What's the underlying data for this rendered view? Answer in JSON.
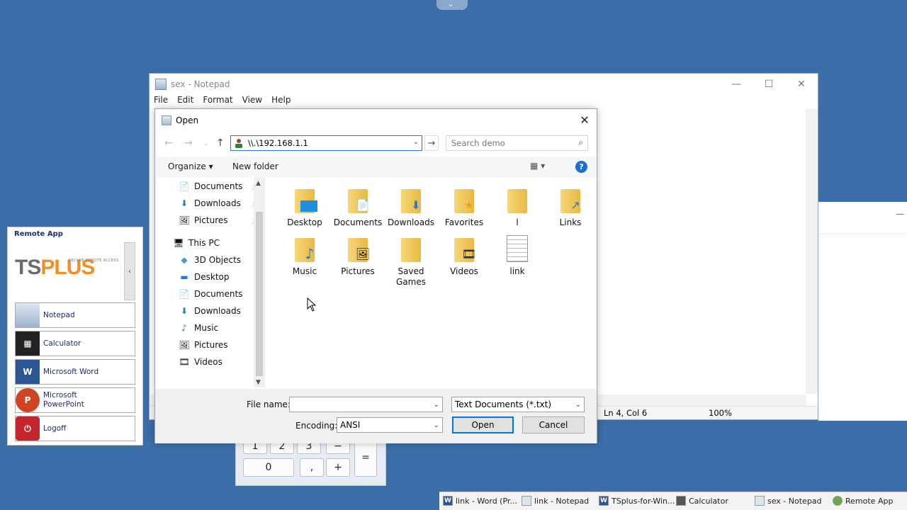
{
  "notepad": {
    "title": "sex - Notepad",
    "menu": [
      "File",
      "Edit",
      "Format",
      "View",
      "Help"
    ],
    "status_position": "Ln 4, Col 6",
    "status_zoom": "100%"
  },
  "calculator": {
    "keys_row1": [
      "1",
      "2",
      "3",
      "−"
    ],
    "keys_row2": [
      "0",
      ",",
      "+"
    ],
    "equals": "="
  },
  "remote_app": {
    "title": "Remote App",
    "logo_ts": "TS",
    "logo_plus": "PLUS",
    "tagline": "SECURE REMOTE ACCESS",
    "buttons": [
      "Notepad",
      "Calculator",
      "Microsoft Word",
      "Microsoft PowerPoint",
      "Logoff"
    ]
  },
  "taskbar": {
    "items": [
      "link - Word (Pr...",
      "link - Notepad",
      "TSplus-for-Win...",
      "Calculator",
      "sex - Notepad",
      "Remote App"
    ]
  },
  "dialog": {
    "title": "Open",
    "address_value": "\\\\.\\192.168.1.1",
    "search_placeholder": "Search demo",
    "organize": "Organize ▾",
    "new_folder": "New folder",
    "nav": {
      "quick_access": [
        "Documents",
        "Downloads",
        "Pictures"
      ],
      "this_pc": "This PC",
      "pc_items": [
        "3D Objects",
        "Desktop",
        "Documents",
        "Downloads",
        "Music",
        "Pictures",
        "Videos"
      ]
    },
    "files": [
      "Desktop",
      "Documents",
      "Downloads",
      "Favorites",
      "l",
      "Links",
      "Music",
      "Pictures",
      "Saved Games",
      "Videos",
      "link"
    ],
    "file_name_label": "File name:",
    "file_name_value": "",
    "file_type": "Text Documents (*.txt)",
    "encoding_label": "Encoding:",
    "encoding_value": "ANSI",
    "open_button": "Open",
    "cancel_button": "Cancel"
  },
  "colors": {
    "desktop": "#3b6ea8",
    "accent": "#0078d7",
    "folder": "#f0c75e"
  }
}
